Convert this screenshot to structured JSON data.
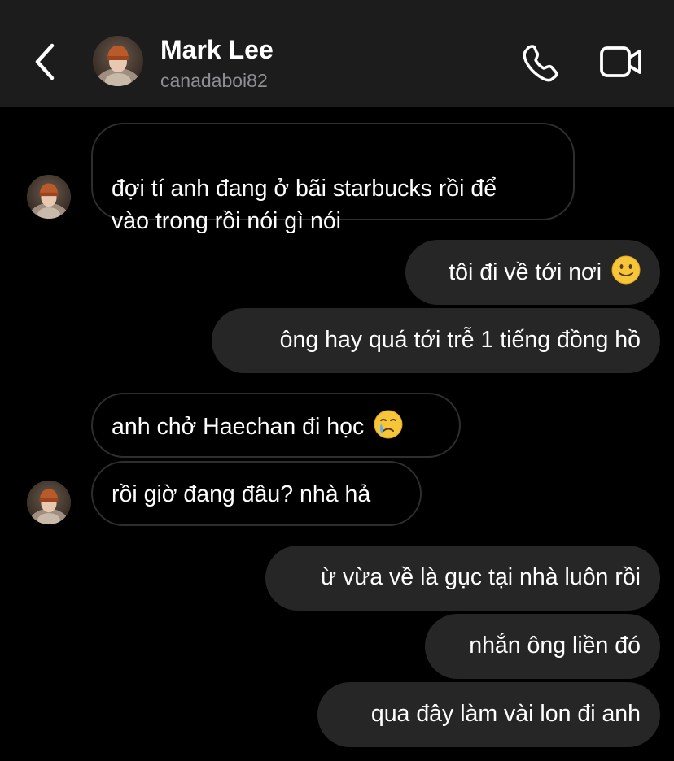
{
  "header": {
    "name": "Mark Lee",
    "username": "canadaboi82",
    "back_icon": "chevron-left-icon",
    "call_icon": "phone-icon",
    "video_icon": "video-camera-icon"
  },
  "colors": {
    "background": "#000000",
    "header_background": "#1c1c1c",
    "sent_bubble": "#262626",
    "received_bubble_border": "#2e2e2e",
    "username_text": "#8e8e93"
  },
  "messages": [
    {
      "from": "received",
      "text": "đợi tí anh đang ở bãi starbucks rồi để\nvào trong rồi nói gì nói"
    },
    {
      "from": "sent",
      "text": "tôi đi về tới nơi",
      "emoji": "slightly-smiling-face"
    },
    {
      "from": "sent",
      "text": "ông hay quá tới trễ 1 tiếng đồng hồ"
    },
    {
      "from": "received",
      "text": "anh chở Haechan đi học",
      "emoji": "crying-face"
    },
    {
      "from": "received",
      "text": "rồi giờ đang đâu? nhà hả"
    },
    {
      "from": "sent",
      "text": "ừ vừa về là gục tại nhà luôn rồi"
    },
    {
      "from": "sent",
      "text": "nhắn ông liền đó"
    },
    {
      "from": "sent",
      "text": "qua đây làm vài lon đi anh"
    }
  ]
}
